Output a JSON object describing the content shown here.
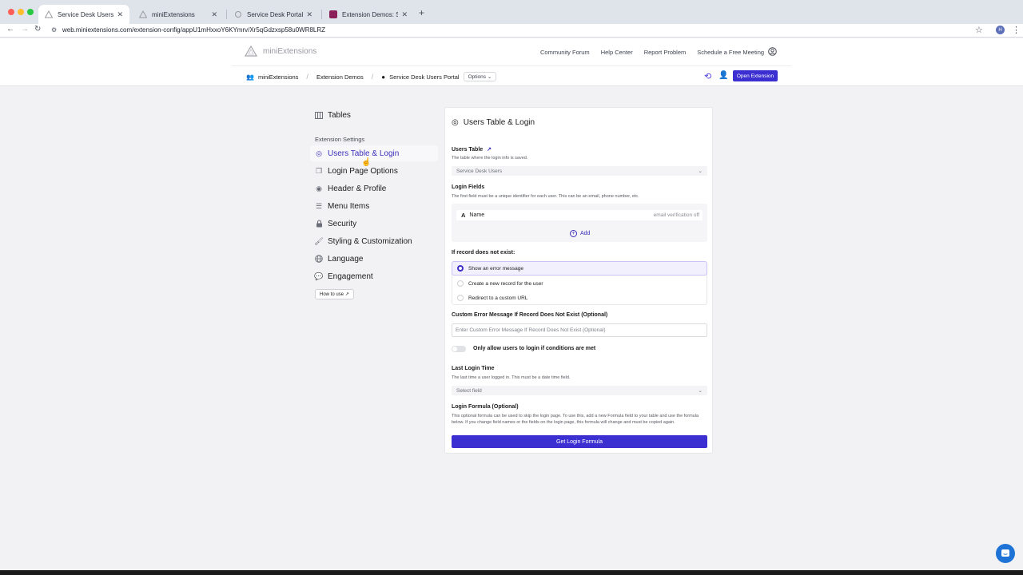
{
  "browser": {
    "tabs": [
      {
        "title": "Service Desk Users Portal - m",
        "active": true
      },
      {
        "title": "miniExtensions",
        "active": false
      },
      {
        "title": "Service Desk Portal",
        "active": false
      },
      {
        "title": "Extension Demos: Service Desk",
        "active": false
      }
    ],
    "url": "web.miniextensions.com/extension-config/appU1mHxxoY6KYmrv/Xr5qGdzxsp58u0WR8LRZ",
    "profile_initial": "H"
  },
  "header": {
    "logo_text": "miniExtensions",
    "links": [
      "Community Forum",
      "Help Center",
      "Report Problem",
      "Schedule a Free Meeting"
    ],
    "breadcrumbs": [
      "miniExtensions",
      "Extension Demos",
      "Service Desk Users Portal"
    ],
    "options_label": "Options",
    "open_button": "Open Extension"
  },
  "sidebar": {
    "tables_label": "Tables",
    "section_label": "Extension Settings",
    "items": [
      {
        "label": "Users Table & Login",
        "icon": "target-icon",
        "active": true
      },
      {
        "label": "Login Page Options",
        "icon": "pages-icon",
        "active": false
      },
      {
        "label": "Header & Profile",
        "icon": "profile-icon",
        "active": false
      },
      {
        "label": "Menu Items",
        "icon": "list-icon",
        "active": false
      },
      {
        "label": "Security",
        "icon": "lock-icon",
        "active": false
      },
      {
        "label": "Styling & Customization",
        "icon": "brush-icon",
        "active": false
      },
      {
        "label": "Language",
        "icon": "globe-icon",
        "active": false
      },
      {
        "label": "Engagement",
        "icon": "chat-icon",
        "active": false
      }
    ],
    "how_to_use": "How to use"
  },
  "panel": {
    "title": "Users Table & Login",
    "users_table": {
      "label": "Users Table",
      "hint": "The table where the login info is saved.",
      "value": "Service Desk Users"
    },
    "login_fields": {
      "label": "Login Fields",
      "hint": "The first field must be a unique identifier for each user. This can be an email, phone number, etc.",
      "field_icon": "A",
      "field_name": "Name",
      "field_meta": "email verification off",
      "add_label": "Add"
    },
    "record_not_exist": {
      "label": "If record does not exist:",
      "options": [
        "Show an error message",
        "Create a new record for the user",
        "Redirect to a custom URL"
      ],
      "selected": 0
    },
    "custom_error": {
      "label": "Custom Error Message If Record Does Not Exist (Optional)",
      "placeholder": "Enter Custom Error Message If Record Does Not Exist (Optional)"
    },
    "conditions_toggle": {
      "label": "Only allow users to login if conditions are met",
      "on": false
    },
    "last_login": {
      "label": "Last Login Time",
      "hint": "The last time a user logged in. This must be a date time field.",
      "placeholder": "Select field"
    },
    "login_formula": {
      "label": "Login Formula (Optional)",
      "hint": "This optional formula can be used to skip the login page. To use this, add a new Formula field to your table and use the formula below. If you change field names or the fields on the login page, this formula will change and must be copied again.",
      "button": "Get Login Formula"
    }
  },
  "colors": {
    "accent": "#3b2fd1",
    "accent_text": "#3b2fb8",
    "background": "#f2f2f4"
  }
}
